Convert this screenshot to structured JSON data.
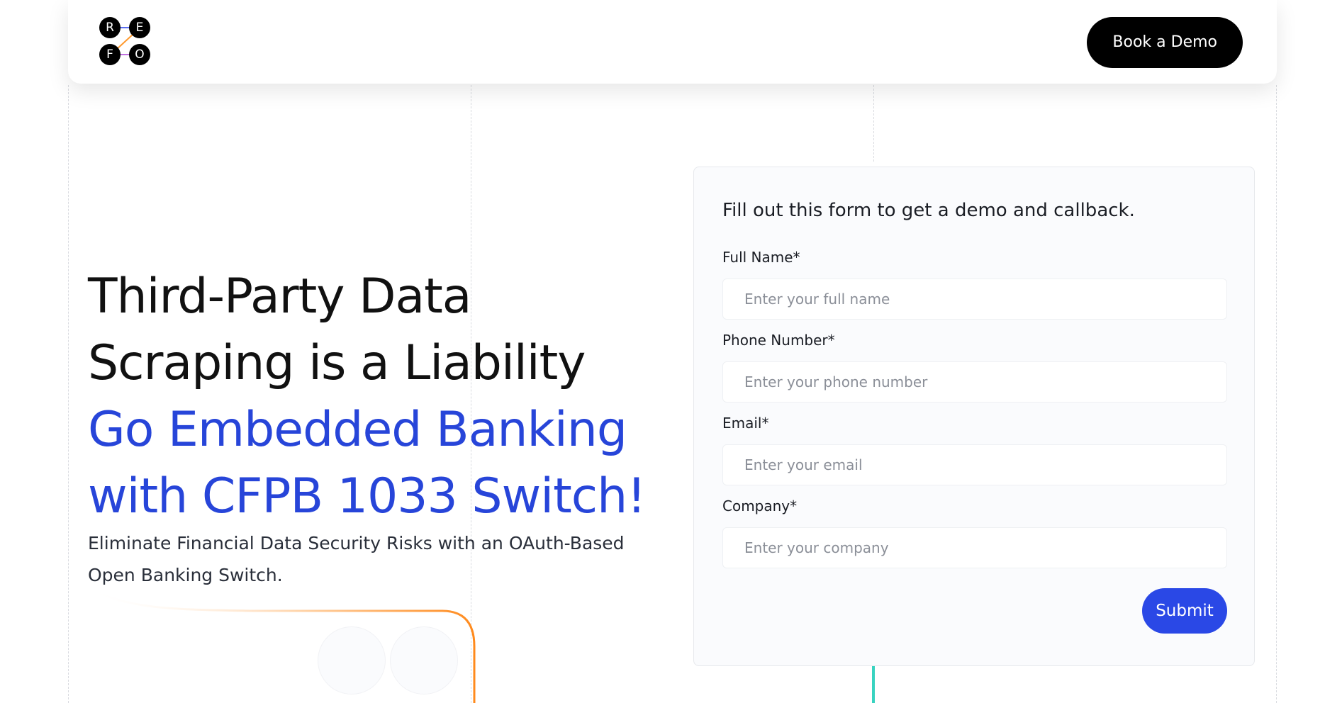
{
  "brand": {
    "logo_letters": [
      "R",
      "E",
      "F",
      "O"
    ],
    "colors": {
      "accent": "#2745d9",
      "button_blue": "#2a48e6",
      "dark": "#000000",
      "curve_orange": "#ff8a1c",
      "teal": "#38d3c0"
    }
  },
  "nav": {
    "cta_label": "Book a Demo"
  },
  "hero": {
    "title_lines": [
      "Third-Party Data",
      "Scraping is a Liability"
    ],
    "highlight_lines": [
      "Go Embedded Banking",
      "with CFPB 1033 Switch!"
    ],
    "subtitle": "Eliminate Financial Data Security Risks with an OAuth-Based Open Banking Switch."
  },
  "form": {
    "heading": "Fill out this form to get a demo and callback.",
    "fields": [
      {
        "label": "Full Name*",
        "placeholder": "Enter your full name",
        "value": ""
      },
      {
        "label": "Phone Number*",
        "placeholder": "Enter your phone number",
        "value": ""
      },
      {
        "label": "Email*",
        "placeholder": "Enter your email",
        "value": ""
      },
      {
        "label": "Company*",
        "placeholder": "Enter your company",
        "value": ""
      }
    ],
    "submit_label": "Submit"
  }
}
